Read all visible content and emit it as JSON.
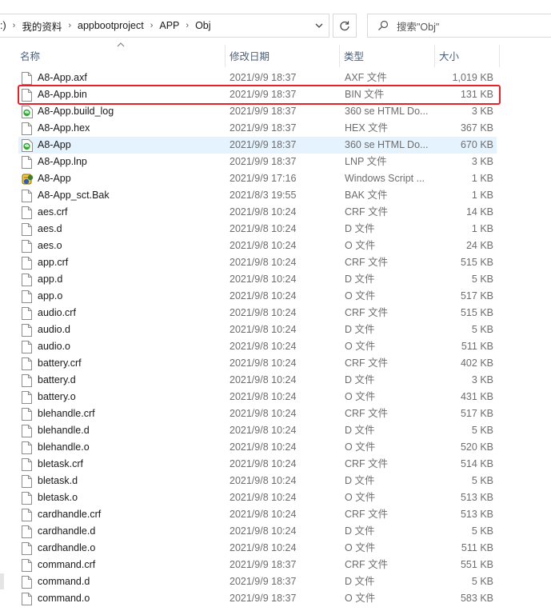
{
  "address": {
    "crumbs": [
      ":)",
      "我的资料",
      "appbootproject",
      "APP",
      "Obj"
    ]
  },
  "search": {
    "placeholder": "搜索\"Obj\""
  },
  "columns": {
    "name": "名称",
    "date": "修改日期",
    "type": "类型",
    "size": "大小"
  },
  "files": [
    {
      "name": "A8-App.axf",
      "date": "2021/9/9 18:37",
      "type": "AXF 文件",
      "size": "1,019 KB",
      "icon": "file-icon"
    },
    {
      "name": "A8-App.bin",
      "date": "2021/9/9 18:37",
      "type": "BIN 文件",
      "size": "131 KB",
      "icon": "file-icon"
    },
    {
      "name": "A8-App.build_log",
      "date": "2021/9/9 18:37",
      "type": "360 se HTML Do...",
      "size": "3 KB",
      "icon": "html-doc-icon"
    },
    {
      "name": "A8-App.hex",
      "date": "2021/9/9 18:37",
      "type": "HEX 文件",
      "size": "367 KB",
      "icon": "file-icon"
    },
    {
      "name": "A8-App",
      "date": "2021/9/9 18:37",
      "type": "360 se HTML Do...",
      "size": "670 KB",
      "icon": "html-doc-icon"
    },
    {
      "name": "A8-App.lnp",
      "date": "2021/9/9 18:37",
      "type": "LNP 文件",
      "size": "3 KB",
      "icon": "file-icon"
    },
    {
      "name": "A8-App",
      "date": "2021/9/9 17:16",
      "type": "Windows Script ...",
      "size": "1 KB",
      "icon": "script-icon"
    },
    {
      "name": "A8-App_sct.Bak",
      "date": "2021/8/3 19:55",
      "type": "BAK 文件",
      "size": "1 KB",
      "icon": "file-icon"
    },
    {
      "name": "aes.crf",
      "date": "2021/9/8 10:24",
      "type": "CRF 文件",
      "size": "14 KB",
      "icon": "file-icon"
    },
    {
      "name": "aes.d",
      "date": "2021/9/8 10:24",
      "type": "D 文件",
      "size": "1 KB",
      "icon": "file-icon"
    },
    {
      "name": "aes.o",
      "date": "2021/9/8 10:24",
      "type": "O 文件",
      "size": "24 KB",
      "icon": "file-icon"
    },
    {
      "name": "app.crf",
      "date": "2021/9/8 10:24",
      "type": "CRF 文件",
      "size": "515 KB",
      "icon": "file-icon"
    },
    {
      "name": "app.d",
      "date": "2021/9/8 10:24",
      "type": "D 文件",
      "size": "5 KB",
      "icon": "file-icon"
    },
    {
      "name": "app.o",
      "date": "2021/9/8 10:24",
      "type": "O 文件",
      "size": "517 KB",
      "icon": "file-icon"
    },
    {
      "name": "audio.crf",
      "date": "2021/9/8 10:24",
      "type": "CRF 文件",
      "size": "515 KB",
      "icon": "file-icon"
    },
    {
      "name": "audio.d",
      "date": "2021/9/8 10:24",
      "type": "D 文件",
      "size": "5 KB",
      "icon": "file-icon"
    },
    {
      "name": "audio.o",
      "date": "2021/9/8 10:24",
      "type": "O 文件",
      "size": "511 KB",
      "icon": "file-icon"
    },
    {
      "name": "battery.crf",
      "date": "2021/9/8 10:24",
      "type": "CRF 文件",
      "size": "402 KB",
      "icon": "file-icon"
    },
    {
      "name": "battery.d",
      "date": "2021/9/8 10:24",
      "type": "D 文件",
      "size": "3 KB",
      "icon": "file-icon"
    },
    {
      "name": "battery.o",
      "date": "2021/9/8 10:24",
      "type": "O 文件",
      "size": "431 KB",
      "icon": "file-icon"
    },
    {
      "name": "blehandle.crf",
      "date": "2021/9/8 10:24",
      "type": "CRF 文件",
      "size": "517 KB",
      "icon": "file-icon"
    },
    {
      "name": "blehandle.d",
      "date": "2021/9/8 10:24",
      "type": "D 文件",
      "size": "5 KB",
      "icon": "file-icon"
    },
    {
      "name": "blehandle.o",
      "date": "2021/9/8 10:24",
      "type": "O 文件",
      "size": "520 KB",
      "icon": "file-icon"
    },
    {
      "name": "bletask.crf",
      "date": "2021/9/8 10:24",
      "type": "CRF 文件",
      "size": "514 KB",
      "icon": "file-icon"
    },
    {
      "name": "bletask.d",
      "date": "2021/9/8 10:24",
      "type": "D 文件",
      "size": "5 KB",
      "icon": "file-icon"
    },
    {
      "name": "bletask.o",
      "date": "2021/9/8 10:24",
      "type": "O 文件",
      "size": "513 KB",
      "icon": "file-icon"
    },
    {
      "name": "cardhandle.crf",
      "date": "2021/9/8 10:24",
      "type": "CRF 文件",
      "size": "513 KB",
      "icon": "file-icon"
    },
    {
      "name": "cardhandle.d",
      "date": "2021/9/8 10:24",
      "type": "D 文件",
      "size": "5 KB",
      "icon": "file-icon"
    },
    {
      "name": "cardhandle.o",
      "date": "2021/9/8 10:24",
      "type": "O 文件",
      "size": "511 KB",
      "icon": "file-icon"
    },
    {
      "name": "command.crf",
      "date": "2021/9/9 18:37",
      "type": "CRF 文件",
      "size": "551 KB",
      "icon": "file-icon"
    },
    {
      "name": "command.d",
      "date": "2021/9/9 18:37",
      "type": "D 文件",
      "size": "5 KB",
      "icon": "file-icon"
    },
    {
      "name": "command.o",
      "date": "2021/9/9 18:37",
      "type": "O 文件",
      "size": "583 KB",
      "icon": "file-icon"
    }
  ],
  "selected_index": 4,
  "highlighted_index": 1,
  "colors": {
    "highlight_border": "#e8202a",
    "selected_row": "#e5f3ff",
    "header_text": "#4c607a"
  }
}
